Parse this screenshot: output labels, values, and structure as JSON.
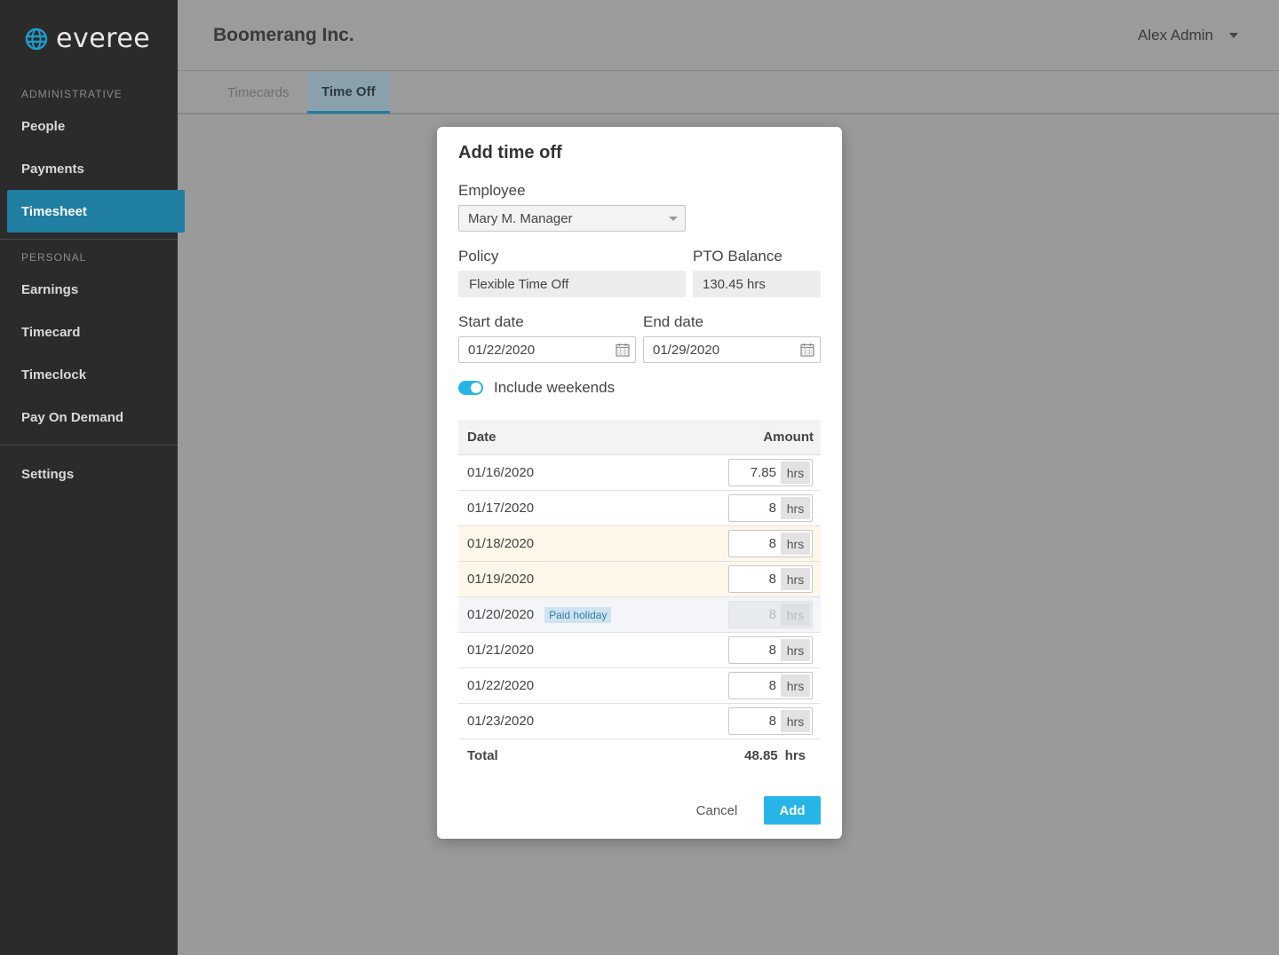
{
  "brand": {
    "name": "everee",
    "color": "#1f7ea1"
  },
  "sidebar": {
    "administrative_label": "ADMINISTRATIVE",
    "admin_items": [
      {
        "label": "People"
      },
      {
        "label": "Payments"
      },
      {
        "label": "Timesheet",
        "active": true
      }
    ],
    "personal_label": "PERSONAL",
    "personal_items": [
      {
        "label": "Earnings"
      },
      {
        "label": "Timecard"
      },
      {
        "label": "Timeclock"
      },
      {
        "label": "Pay On Demand"
      }
    ],
    "settings_label": "Settings"
  },
  "header": {
    "company": "Boomerang Inc.",
    "user": "Alex Admin",
    "user_icon": "chevron-down-icon"
  },
  "tabs": [
    {
      "label": "Timecards"
    },
    {
      "label": "Time Off",
      "active": true
    }
  ],
  "modal": {
    "title": "Add time off",
    "employee_label": "Employee",
    "employee_value": "Mary M. Manager",
    "policy_label": "Policy",
    "policy_value": "Flexible Time Off",
    "pto_label": "PTO Balance",
    "pto_value": "130.45 hrs",
    "start_label": "Start date",
    "start_value": "01/22/2020",
    "end_label": "End date",
    "end_value": "01/29/2020",
    "weekends_label": "Include weekends",
    "weekends_on": true,
    "table": {
      "col_date": "Date",
      "col_amount": "Amount",
      "unit": "hrs",
      "rows": [
        {
          "date": "01/16/2020",
          "amount": "7.85"
        },
        {
          "date": "01/17/2020",
          "amount": "8"
        },
        {
          "date": "01/18/2020",
          "amount": "8",
          "weekend": true
        },
        {
          "date": "01/19/2020",
          "amount": "8",
          "weekend": true
        },
        {
          "date": "01/20/2020",
          "amount": "8",
          "holiday": "Paid holiday"
        },
        {
          "date": "01/21/2020",
          "amount": "8"
        },
        {
          "date": "01/22/2020",
          "amount": "8"
        },
        {
          "date": "01/23/2020",
          "amount": "8"
        }
      ],
      "total_label": "Total",
      "total_value": "48.85",
      "total_unit": "hrs"
    },
    "cancel_label": "Cancel",
    "add_label": "Add"
  },
  "colors": {
    "accent": "#27b5e8",
    "sidebar_active": "#1f7ea1",
    "weekend_row": "#fdf7e9"
  }
}
